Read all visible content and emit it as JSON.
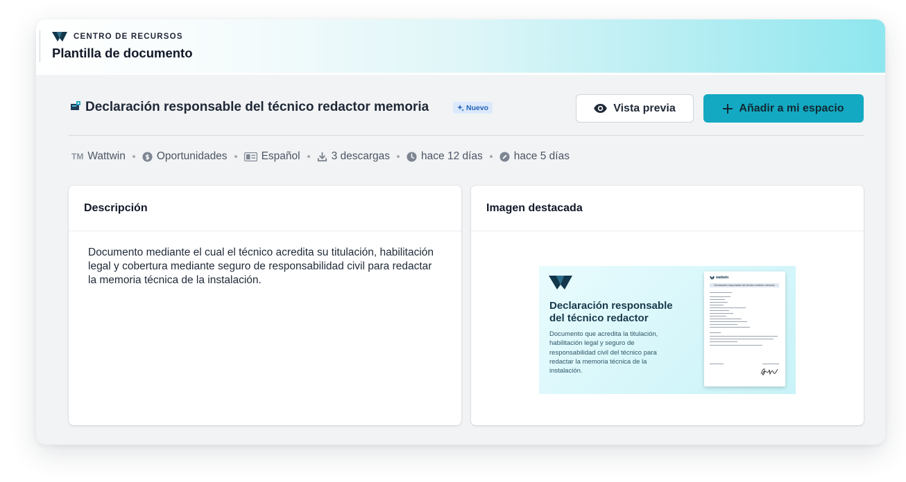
{
  "banner": {
    "eyebrow": "CENTRO DE RECURSOS",
    "title": "Plantilla de documento"
  },
  "document": {
    "title": "Declaración responsable del técnico redactor memoria",
    "badge": "Nuevo"
  },
  "actions": {
    "preview_label": "Vista previa",
    "add_label": "Añadir a mi espacio"
  },
  "meta": {
    "brand_mark": "TM",
    "author": "Wattwin",
    "category": "Oportunidades",
    "language": "Español",
    "downloads": "3 descargas",
    "created": "hace 12 días",
    "updated": "hace 5 días"
  },
  "description_card": {
    "heading": "Descripción",
    "text": "Documento mediante el cual el técnico acredita su titulación, habilitación legal y cobertura mediante seguro de responsabilidad civil para redactar la memoria técnica de la instalación."
  },
  "image_card": {
    "heading": "Imagen destacada",
    "feature_title": "Declaración responsable del técnico redactor",
    "feature_text": "Documento que acredita la titulación, habilitación legal y seguro de responsabilidad civil del técnico para redactar la memoria técnica de la instalación.",
    "paper_brand": "wattwin",
    "paper_heading": "Declaración responsable del técnico redactor memoria"
  },
  "colors": {
    "accent": "#14a9c2",
    "badge_bg": "#dbe9fb",
    "badge_text": "#2563b8",
    "brand_dark": "#12364a"
  },
  "icons": {
    "logo": "wattwin-logo-icon",
    "document": "document-type-icon",
    "badge": "sparkle-icon",
    "preview": "eye-icon",
    "add": "plus-icon",
    "category": "dollar-circle-icon",
    "language": "language-card-icon",
    "downloads": "download-icon",
    "created": "clock-icon",
    "updated": "edit-circle-icon"
  }
}
